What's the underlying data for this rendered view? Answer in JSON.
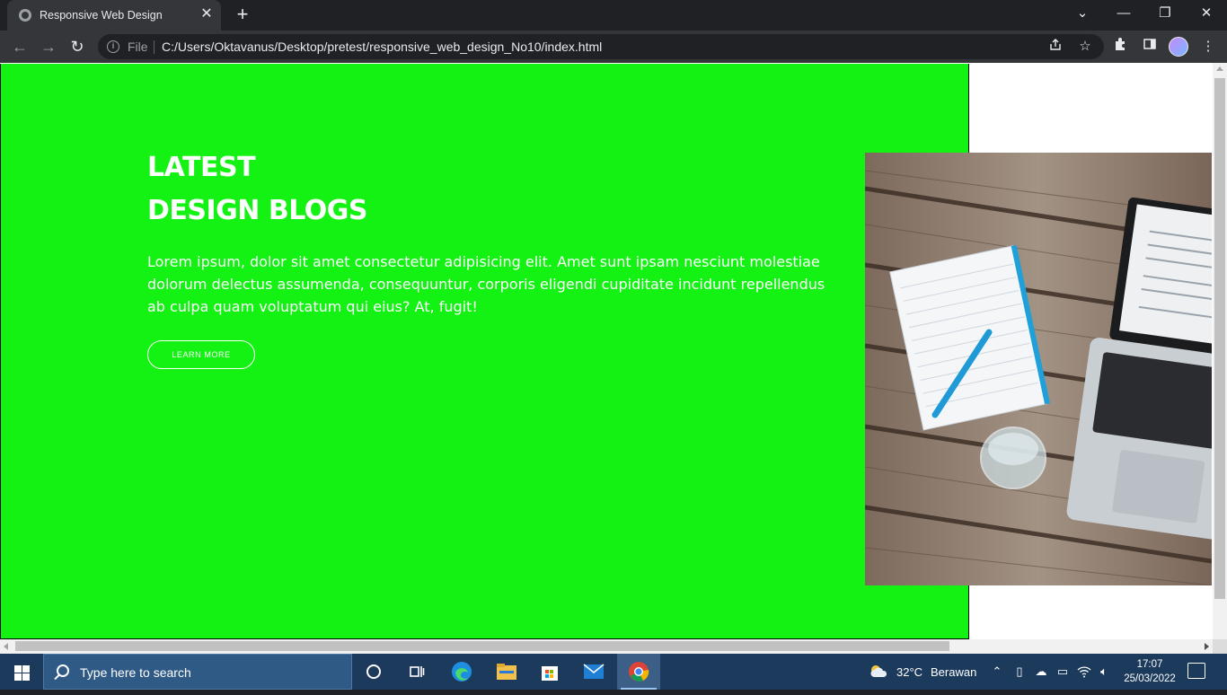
{
  "browser": {
    "tab_title": "Responsive Web Design",
    "tab_close": "✕",
    "new_tab": "+",
    "window_controls": {
      "tab_search": "⌄",
      "minimize": "—",
      "restore": "❐",
      "close": "✕"
    },
    "nav": {
      "back": "←",
      "forward": "→",
      "reload": "↻"
    },
    "security_label": "File",
    "url": "C:/Users/Oktavanus/Desktop/pretest/responsive_web_design_No10/index.html",
    "icons": [
      "share-icon",
      "star-icon",
      "extensions-icon",
      "side-panel-icon",
      "profile-avatar",
      "menu-icon"
    ]
  },
  "page": {
    "hero_bg": "#13f213",
    "heading_line1": "LATEST",
    "heading_line2": "DESIGN BLOGS",
    "lead": "Lorem ipsum, dolor sit amet consectetur adipisicing elit. Amet sunt ipsam nesciunt molestiae dolorum delectus assumenda, consequuntur, corporis eligendi cupiditate incidunt repellendus ab culpa quam voluptatum qui eius? At, fugit!",
    "button_label": "LEARN MORE",
    "image_subject": "laptop, notebook, pen and glass of water on a wooden table"
  },
  "taskbar": {
    "search_placeholder": "Type here to search",
    "apps": [
      "task-view-icon",
      "widgets-icon",
      "edge-icon",
      "file-explorer-icon",
      "store-icon",
      "mail-icon",
      "chrome-icon"
    ],
    "weather_temp": "32°C",
    "weather_desc": "Berawan",
    "time": "17:07",
    "date": "25/03/2022"
  }
}
